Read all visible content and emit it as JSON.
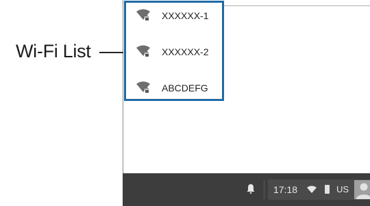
{
  "callout": {
    "label": "Wi-Fi List"
  },
  "wifi_networks": [
    {
      "ssid": "XXXXXX-1",
      "icon": "wifi-lock-icon"
    },
    {
      "ssid": "XXXXXX-2",
      "icon": "wifi-lock-icon"
    },
    {
      "ssid": "ABCDEFG",
      "icon": "wifi-lock-icon"
    }
  ],
  "taskbar": {
    "time": "17:18",
    "locale": "US",
    "icons": [
      "bell-icon",
      "wifi-icon",
      "battery-icon",
      "avatar-icon"
    ]
  },
  "colors": {
    "highlight_border": "#1f6aa5",
    "taskbar_bg": "#3d3d3d"
  }
}
